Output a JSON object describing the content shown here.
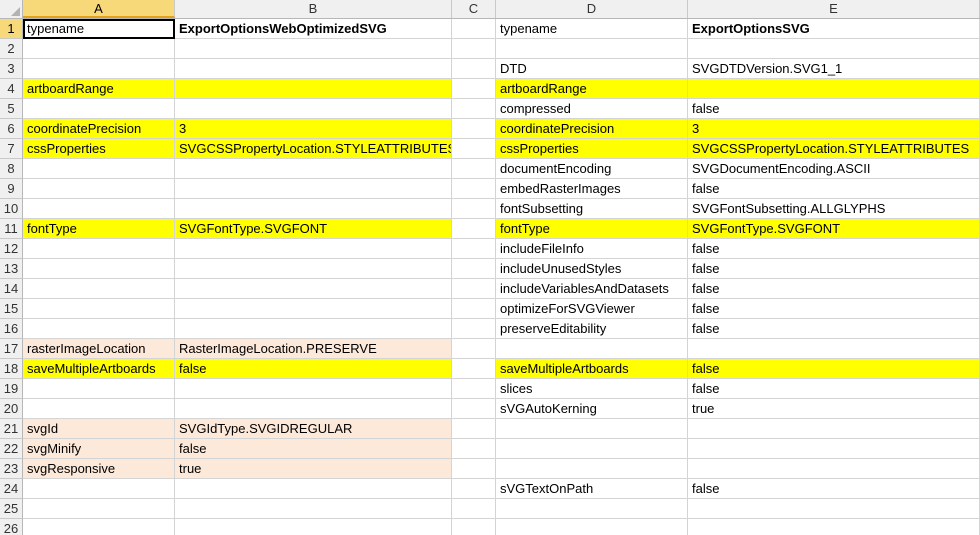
{
  "columns": [
    "A",
    "B",
    "C",
    "D",
    "E"
  ],
  "colors": {
    "yellow": "#ffff00",
    "peach": "#fde9d9"
  },
  "rows": [
    {
      "num": "1",
      "a": "typename",
      "b": "ExportOptionsWebOptimizedSVG",
      "d": "typename",
      "e": "ExportOptionsSVG",
      "hlLeft": "",
      "hlRight": ""
    },
    {
      "num": "2",
      "a": "",
      "b": "",
      "d": "",
      "e": "",
      "hlLeft": "",
      "hlRight": ""
    },
    {
      "num": "3",
      "a": "",
      "b": "",
      "d": "DTD",
      "e": "SVGDTDVersion.SVG1_1",
      "hlLeft": "",
      "hlRight": ""
    },
    {
      "num": "4",
      "a": "artboardRange",
      "b": "",
      "d": "artboardRange",
      "e": "",
      "hlLeft": "yellow",
      "hlRight": "yellow"
    },
    {
      "num": "5",
      "a": "",
      "b": "",
      "d": "compressed",
      "e": "false",
      "hlLeft": "",
      "hlRight": ""
    },
    {
      "num": "6",
      "a": "coordinatePrecision",
      "b": "3",
      "d": "coordinatePrecision",
      "e": "3",
      "hlLeft": "yellow",
      "hlRight": "yellow"
    },
    {
      "num": "7",
      "a": "cssProperties",
      "b": "SVGCSSPropertyLocation.STYLEATTRIBUTES",
      "d": "cssProperties",
      "e": "SVGCSSPropertyLocation.STYLEATTRIBUTES",
      "hlLeft": "yellow",
      "hlRight": "yellow"
    },
    {
      "num": "8",
      "a": "",
      "b": "",
      "d": "documentEncoding",
      "e": "SVGDocumentEncoding.ASCII",
      "hlLeft": "",
      "hlRight": ""
    },
    {
      "num": "9",
      "a": "",
      "b": "",
      "d": "embedRasterImages",
      "e": "false",
      "hlLeft": "",
      "hlRight": ""
    },
    {
      "num": "10",
      "a": "",
      "b": "",
      "d": "fontSubsetting",
      "e": "SVGFontSubsetting.ALLGLYPHS",
      "hlLeft": "",
      "hlRight": ""
    },
    {
      "num": "11",
      "a": "fontType",
      "b": "SVGFontType.SVGFONT",
      "d": "fontType",
      "e": "SVGFontType.SVGFONT",
      "hlLeft": "yellow",
      "hlRight": "yellow"
    },
    {
      "num": "12",
      "a": "",
      "b": "",
      "d": "includeFileInfo",
      "e": "false",
      "hlLeft": "",
      "hlRight": ""
    },
    {
      "num": "13",
      "a": "",
      "b": "",
      "d": "includeUnusedStyles",
      "e": "false",
      "hlLeft": "",
      "hlRight": ""
    },
    {
      "num": "14",
      "a": "",
      "b": "",
      "d": "includeVariablesAndDatasets",
      "e": "false",
      "hlLeft": "",
      "hlRight": ""
    },
    {
      "num": "15",
      "a": "",
      "b": "",
      "d": "optimizeForSVGViewer",
      "e": "false",
      "hlLeft": "",
      "hlRight": ""
    },
    {
      "num": "16",
      "a": "",
      "b": "",
      "d": "preserveEditability",
      "e": "false",
      "hlLeft": "",
      "hlRight": ""
    },
    {
      "num": "17",
      "a": "rasterImageLocation",
      "b": "RasterImageLocation.PRESERVE",
      "d": "",
      "e": "",
      "hlLeft": "peach",
      "hlRight": ""
    },
    {
      "num": "18",
      "a": "saveMultipleArtboards",
      "b": "false",
      "d": "saveMultipleArtboards",
      "e": "false",
      "hlLeft": "yellow",
      "hlRight": "yellow"
    },
    {
      "num": "19",
      "a": "",
      "b": "",
      "d": "slices",
      "e": "false",
      "hlLeft": "",
      "hlRight": ""
    },
    {
      "num": "20",
      "a": "",
      "b": "",
      "d": "sVGAutoKerning",
      "e": "true",
      "hlLeft": "",
      "hlRight": ""
    },
    {
      "num": "21",
      "a": "svgId",
      "b": "SVGIdType.SVGIDREGULAR",
      "d": "",
      "e": "",
      "hlLeft": "peach",
      "hlRight": ""
    },
    {
      "num": "22",
      "a": "svgMinify",
      "b": "false",
      "d": "",
      "e": "",
      "hlLeft": "peach",
      "hlRight": ""
    },
    {
      "num": "23",
      "a": "svgResponsive",
      "b": "true",
      "d": "",
      "e": "",
      "hlLeft": "peach",
      "hlRight": ""
    },
    {
      "num": "24",
      "a": "",
      "b": "",
      "d": "sVGTextOnPath",
      "e": "false",
      "hlLeft": "",
      "hlRight": ""
    },
    {
      "num": "25",
      "a": "",
      "b": "",
      "d": "",
      "e": "",
      "hlLeft": "",
      "hlRight": ""
    },
    {
      "num": "26",
      "a": "",
      "b": "",
      "d": "",
      "e": "",
      "hlLeft": "",
      "hlRight": ""
    }
  ]
}
